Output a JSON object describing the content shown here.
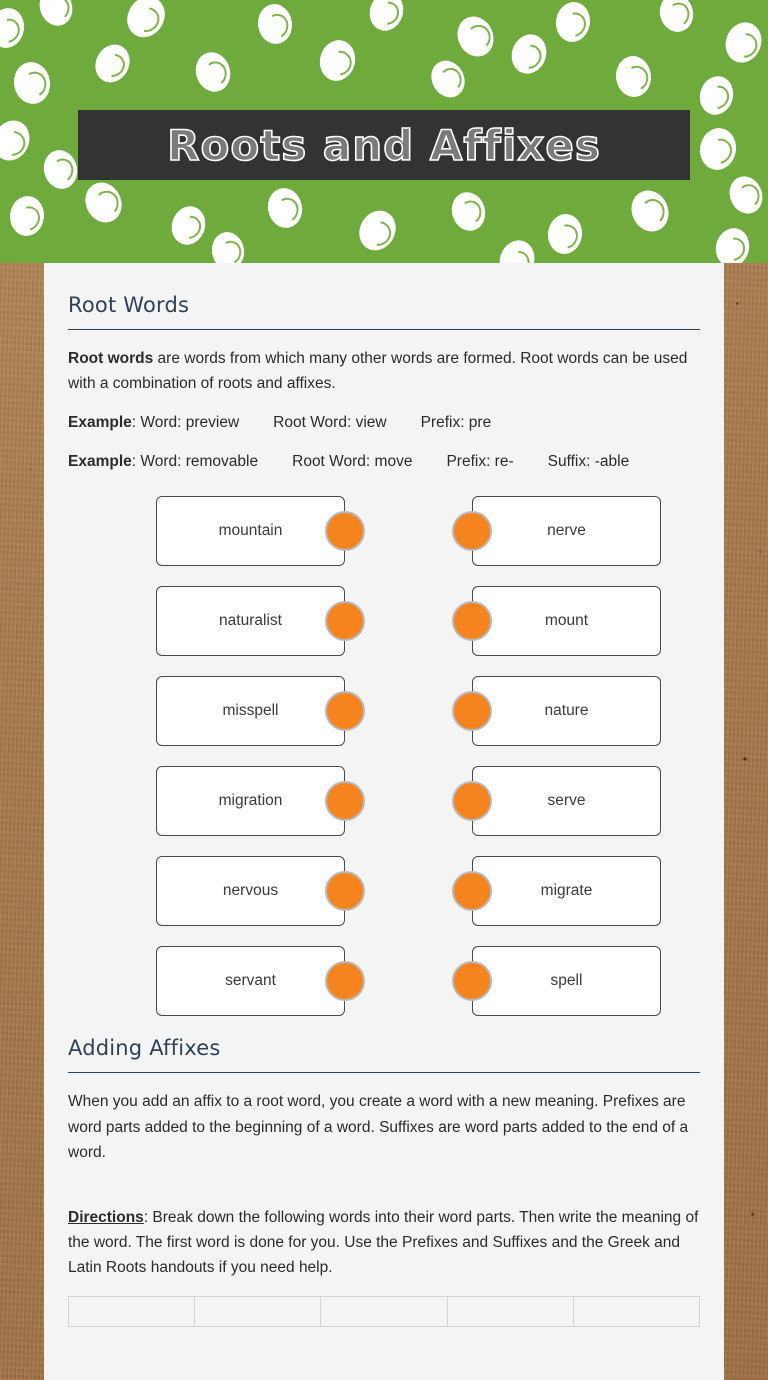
{
  "header": {
    "title": "Roots and Affixes",
    "background_color": "#6faa3c",
    "banner_color": "#333333",
    "pattern_icon": "scribbled-oval-icon"
  },
  "page": {
    "background_color": "#a8794b",
    "sheet_color": "#f4f4f4",
    "accent_color": "#2e4257",
    "dot_color": "#f5841f"
  },
  "sections": {
    "root_words": {
      "title": "Root Words",
      "definition_bold": "Root words",
      "definition_rest": " are words from which many other words are formed. Root words can be used with a combination of roots and affixes.",
      "example1_bold": "Example",
      "example1_word": ": Word: preview",
      "example1_root": "Root Word: view",
      "example1_prefix": "Prefix: pre",
      "example2_bold": "Example",
      "example2_word": ": Word: removable",
      "example2_root": "Root Word: move",
      "example2_prefix": "Prefix: re-",
      "example2_suffix": "Suffix: -able"
    },
    "adding_affixes": {
      "title": "Adding Affixes",
      "paragraph": "When you add an affix to a root word, you create a word with a new meaning. Prefixes are word parts added to the beginning of a word. Suffixes are word parts added to the end of a word.",
      "directions_label": "Directions",
      "directions_text": ": Break down the following words into their word parts. Then write the meaning of the word. The first word is done for you. Use the Prefixes and Suffixes and the Greek and Latin Roots handouts if you need help."
    }
  },
  "match_rows": [
    {
      "left": "mountain",
      "right": "nerve"
    },
    {
      "left": "naturalist",
      "right": "mount"
    },
    {
      "left": "misspell",
      "right": "nature"
    },
    {
      "left": "migration",
      "right": "serve"
    },
    {
      "left": "nervous",
      "right": "migrate"
    },
    {
      "left": "servant",
      "right": "spell"
    }
  ],
  "word_parts_table": {
    "columns": [
      "",
      "",
      "",
      "",
      ""
    ],
    "rows": [
      [
        "",
        "",
        "",
        "",
        ""
      ]
    ]
  }
}
